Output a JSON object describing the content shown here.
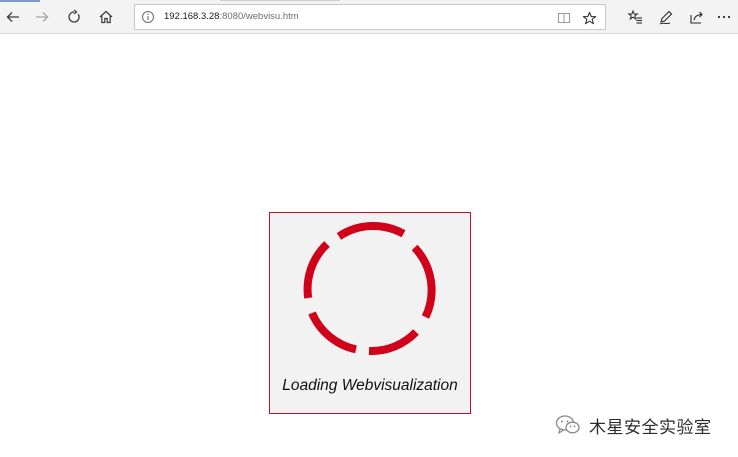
{
  "browser": {
    "url_host": "192.168.3.28",
    "url_rest": ":8080/webvisu.htm",
    "buttons": {
      "back": "back-icon",
      "forward": "forward-icon",
      "refresh": "refresh-icon",
      "home": "home-icon",
      "reading_view": "reading-view-icon",
      "favorite": "star-icon",
      "favorites_list": "favorites-icon",
      "notes": "pen-icon",
      "share": "share-icon",
      "more": "more-icon"
    }
  },
  "loader": {
    "text": "Loading Webvisualization",
    "accent_color": "#d0021b",
    "background": "#f2f2f2"
  },
  "watermark": {
    "text": "木星安全实验室"
  }
}
